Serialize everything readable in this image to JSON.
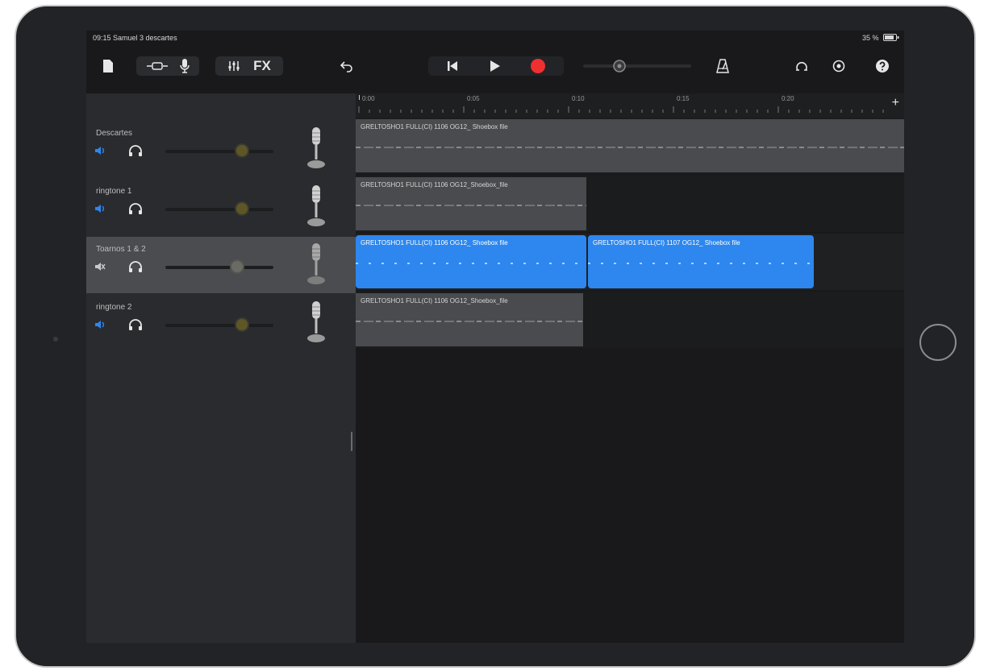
{
  "status_bar": {
    "left_text": "09:15  Samuel 3 descartes",
    "right_text": "35 %"
  },
  "toolbar": {
    "fx_label": "FX",
    "record_color": "#f03030"
  },
  "ruler": {
    "ticks": [
      "0:00",
      "0:05",
      "0:10",
      "0:15",
      "0:20"
    ]
  },
  "tracks": [
    {
      "name": "Descartes"
    },
    {
      "name": "ringtone 1"
    },
    {
      "name": "Toarnos 1 & 2"
    },
    {
      "name": "ringtone 2"
    }
  ],
  "clips": {
    "c1": "GRELTOSHO1 FULL(CI) 1106 OG12_ Shoebox file",
    "c2": "GRELTOSHO1 FULL(CI) 1106 OG12_Shoebox_file",
    "c3": "GRELTOSHO1 FULL(CI) 1106 OG12_ Shoebox file",
    "c4": "GRELTOSHO1 FULL(CI) 1107 OG12_ Shoebox file",
    "c5": "GRELTOSHO1 FULL(CI) 1106 OG12_Shoebox_file"
  },
  "colors": {
    "accent": "#2d87ee",
    "knob": "#5e5626",
    "background": "#19191b"
  }
}
